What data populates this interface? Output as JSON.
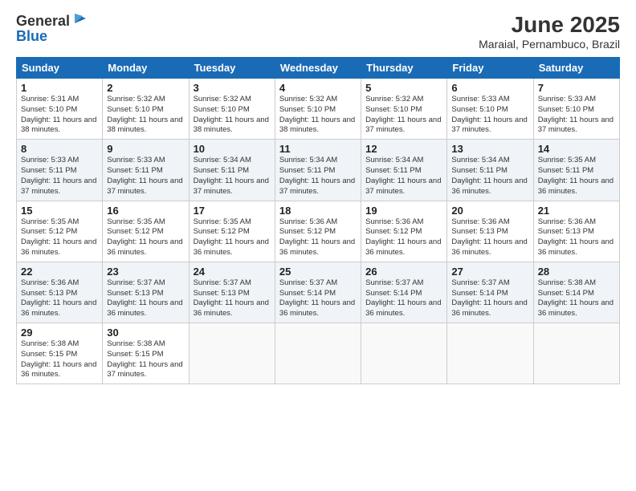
{
  "header": {
    "logo_line1": "General",
    "logo_line2": "Blue",
    "month_title": "June 2025",
    "location": "Maraial, Pernambuco, Brazil"
  },
  "weekdays": [
    "Sunday",
    "Monday",
    "Tuesday",
    "Wednesday",
    "Thursday",
    "Friday",
    "Saturday"
  ],
  "weeks": [
    [
      {
        "day": "1",
        "sunrise": "5:31 AM",
        "sunset": "5:10 PM",
        "daylight": "11 hours and 38 minutes."
      },
      {
        "day": "2",
        "sunrise": "5:32 AM",
        "sunset": "5:10 PM",
        "daylight": "11 hours and 38 minutes."
      },
      {
        "day": "3",
        "sunrise": "5:32 AM",
        "sunset": "5:10 PM",
        "daylight": "11 hours and 38 minutes."
      },
      {
        "day": "4",
        "sunrise": "5:32 AM",
        "sunset": "5:10 PM",
        "daylight": "11 hours and 38 minutes."
      },
      {
        "day": "5",
        "sunrise": "5:32 AM",
        "sunset": "5:10 PM",
        "daylight": "11 hours and 37 minutes."
      },
      {
        "day": "6",
        "sunrise": "5:33 AM",
        "sunset": "5:10 PM",
        "daylight": "11 hours and 37 minutes."
      },
      {
        "day": "7",
        "sunrise": "5:33 AM",
        "sunset": "5:10 PM",
        "daylight": "11 hours and 37 minutes."
      }
    ],
    [
      {
        "day": "8",
        "sunrise": "5:33 AM",
        "sunset": "5:11 PM",
        "daylight": "11 hours and 37 minutes."
      },
      {
        "day": "9",
        "sunrise": "5:33 AM",
        "sunset": "5:11 PM",
        "daylight": "11 hours and 37 minutes."
      },
      {
        "day": "10",
        "sunrise": "5:34 AM",
        "sunset": "5:11 PM",
        "daylight": "11 hours and 37 minutes."
      },
      {
        "day": "11",
        "sunrise": "5:34 AM",
        "sunset": "5:11 PM",
        "daylight": "11 hours and 37 minutes."
      },
      {
        "day": "12",
        "sunrise": "5:34 AM",
        "sunset": "5:11 PM",
        "daylight": "11 hours and 37 minutes."
      },
      {
        "day": "13",
        "sunrise": "5:34 AM",
        "sunset": "5:11 PM",
        "daylight": "11 hours and 36 minutes."
      },
      {
        "day": "14",
        "sunrise": "5:35 AM",
        "sunset": "5:11 PM",
        "daylight": "11 hours and 36 minutes."
      }
    ],
    [
      {
        "day": "15",
        "sunrise": "5:35 AM",
        "sunset": "5:12 PM",
        "daylight": "11 hours and 36 minutes."
      },
      {
        "day": "16",
        "sunrise": "5:35 AM",
        "sunset": "5:12 PM",
        "daylight": "11 hours and 36 minutes."
      },
      {
        "day": "17",
        "sunrise": "5:35 AM",
        "sunset": "5:12 PM",
        "daylight": "11 hours and 36 minutes."
      },
      {
        "day": "18",
        "sunrise": "5:36 AM",
        "sunset": "5:12 PM",
        "daylight": "11 hours and 36 minutes."
      },
      {
        "day": "19",
        "sunrise": "5:36 AM",
        "sunset": "5:12 PM",
        "daylight": "11 hours and 36 minutes."
      },
      {
        "day": "20",
        "sunrise": "5:36 AM",
        "sunset": "5:13 PM",
        "daylight": "11 hours and 36 minutes."
      },
      {
        "day": "21",
        "sunrise": "5:36 AM",
        "sunset": "5:13 PM",
        "daylight": "11 hours and 36 minutes."
      }
    ],
    [
      {
        "day": "22",
        "sunrise": "5:36 AM",
        "sunset": "5:13 PM",
        "daylight": "11 hours and 36 minutes."
      },
      {
        "day": "23",
        "sunrise": "5:37 AM",
        "sunset": "5:13 PM",
        "daylight": "11 hours and 36 minutes."
      },
      {
        "day": "24",
        "sunrise": "5:37 AM",
        "sunset": "5:13 PM",
        "daylight": "11 hours and 36 minutes."
      },
      {
        "day": "25",
        "sunrise": "5:37 AM",
        "sunset": "5:14 PM",
        "daylight": "11 hours and 36 minutes."
      },
      {
        "day": "26",
        "sunrise": "5:37 AM",
        "sunset": "5:14 PM",
        "daylight": "11 hours and 36 minutes."
      },
      {
        "day": "27",
        "sunrise": "5:37 AM",
        "sunset": "5:14 PM",
        "daylight": "11 hours and 36 minutes."
      },
      {
        "day": "28",
        "sunrise": "5:38 AM",
        "sunset": "5:14 PM",
        "daylight": "11 hours and 36 minutes."
      }
    ],
    [
      {
        "day": "29",
        "sunrise": "5:38 AM",
        "sunset": "5:15 PM",
        "daylight": "11 hours and 36 minutes."
      },
      {
        "day": "30",
        "sunrise": "5:38 AM",
        "sunset": "5:15 PM",
        "daylight": "11 hours and 37 minutes."
      },
      null,
      null,
      null,
      null,
      null
    ]
  ]
}
